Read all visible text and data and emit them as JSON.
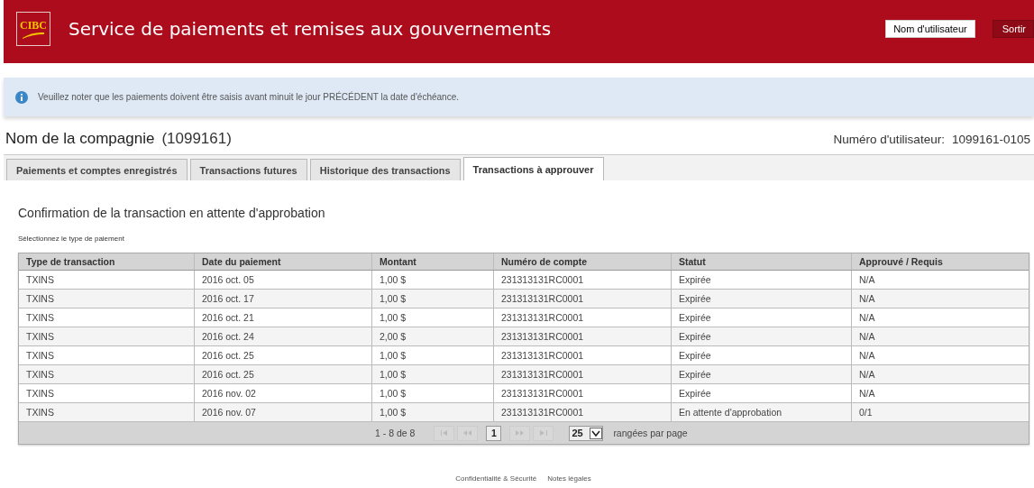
{
  "header": {
    "logo_text": "CIBC",
    "title": "Service de paiements et remises aux gouvernements",
    "user_button": "Nom d'utilisateur",
    "logout_button": "Sortir"
  },
  "notice": "Veuillez noter que les paiements doivent être saisis avant minuit le jour PRÉCÉDENT la date d'échéance.",
  "company": {
    "name": "Nom de la compagnie",
    "number": "(1099161)",
    "user_label": "Numéro d'utilisateur:",
    "user_number": "1099161-0105"
  },
  "tabs": [
    {
      "label": "Paiements et comptes enregistrés",
      "selected": false
    },
    {
      "label": "Transactions futures",
      "selected": false
    },
    {
      "label": "Historique des transactions",
      "selected": false
    },
    {
      "label": "Transactions à approuver",
      "selected": true
    }
  ],
  "section_title": "Confirmation de la transaction en attente d'approbation",
  "section_hint": "Sélectionnez le type de paiement",
  "table": {
    "columns": [
      "Type de transaction",
      "Date du paiement",
      "Montant",
      "Numéro de compte",
      "Statut",
      "Approuvé / Requis"
    ],
    "rows": [
      [
        "TXINS",
        "2016 oct. 05",
        "1,00 $",
        "231313131RC0001",
        "Expirée",
        "N/A"
      ],
      [
        "TXINS",
        "2016 oct. 17",
        "1,00 $",
        "231313131RC0001",
        "Expirée",
        "N/A"
      ],
      [
        "TXINS",
        "2016 oct. 21",
        "1,00 $",
        "231313131RC0001",
        "Expirée",
        "N/A"
      ],
      [
        "TXINS",
        "2016 oct. 24",
        "2,00 $",
        "231313131RC0001",
        "Expirée",
        "N/A"
      ],
      [
        "TXINS",
        "2016 oct. 25",
        "1,00 $",
        "231313131RC0001",
        "Expirée",
        "N/A"
      ],
      [
        "TXINS",
        "2016 oct. 25",
        "1,00 $",
        "231313131RC0001",
        "Expirée",
        "N/A"
      ],
      [
        "TXINS",
        "2016 nov. 02",
        "1,00 $",
        "231313131RC0001",
        "Expirée",
        "N/A"
      ],
      [
        "TXINS",
        "2016 nov. 07",
        "1,00 $",
        "231313131RC0001",
        "En attente d'approbation",
        "0/1"
      ]
    ]
  },
  "pager": {
    "range": "1 - 8 de 8",
    "current_page": "1",
    "page_size": "25",
    "page_size_label": "rangées par page"
  },
  "footer_links": [
    "Confidentialité & Sécurité",
    "Notes légales"
  ]
}
